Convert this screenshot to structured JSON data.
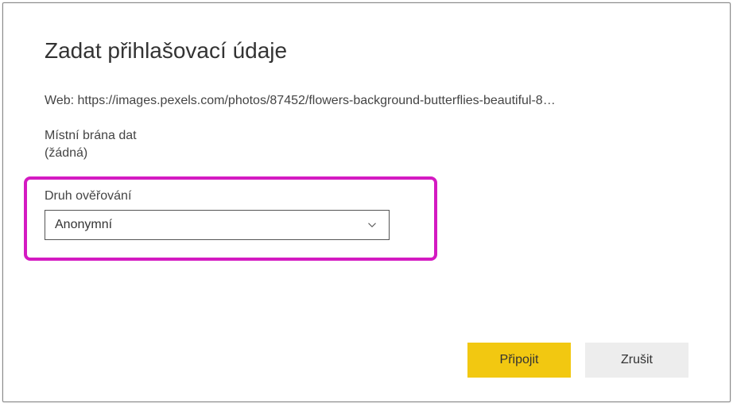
{
  "dialog": {
    "title": "Zadat přihlašovací údaje",
    "web_label": "Web: ",
    "web_url": "https://images.pexels.com/photos/87452/flowers-background-butterflies-beautiful-8…",
    "gateway_label": "Místní brána dat",
    "gateway_value": "(žádná)",
    "auth_label": "Druh ověřování",
    "auth_selected": "Anonymní",
    "connect_label": "Připojit",
    "cancel_label": "Zrušit"
  }
}
